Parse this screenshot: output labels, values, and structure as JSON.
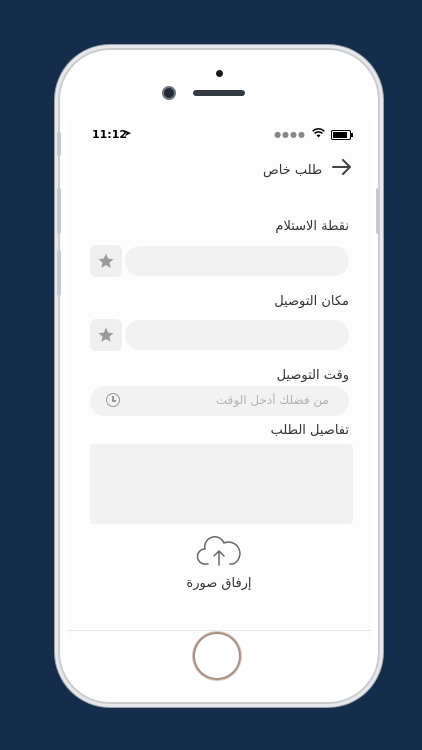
{
  "status_bar": {
    "time": "11:12",
    "location_glyph": "➤"
  },
  "header": {
    "title": "طلب خاص",
    "back_icon": "arrow-right-icon"
  },
  "form": {
    "pickup_label": "نقطة الاستلام",
    "pickup_value": "",
    "delivery_label": "مكان التوصيل",
    "delivery_value": "",
    "time_label": "وقت التوصيل",
    "time_placeholder": "من فضلك أدخل الوقت",
    "details_label": "تفاصيل الطلب",
    "details_value": ""
  },
  "upload": {
    "label": "إرفاق صورة",
    "icon": "cloud-upload-icon"
  },
  "colors": {
    "background": "#132d4b",
    "field": "#f2f2f2",
    "text": "#333333"
  }
}
